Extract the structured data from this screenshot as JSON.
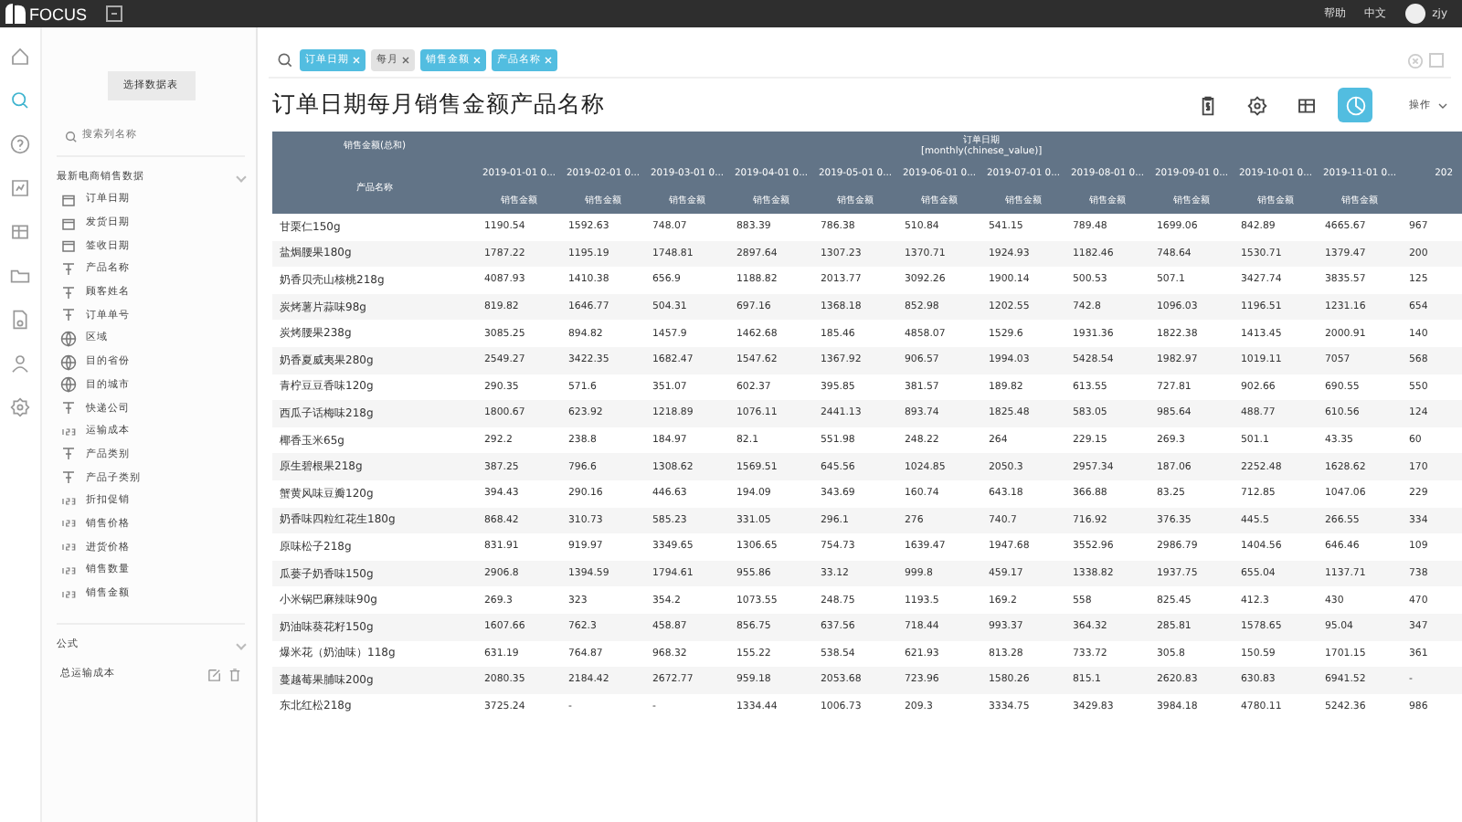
{
  "topbar": {
    "logo": "FOCUS",
    "links": [
      "帮助",
      "中文"
    ],
    "user": "zjy"
  },
  "rail": [
    {
      "kind": "home",
      "selected": false
    },
    {
      "kind": "search",
      "selected": true
    },
    {
      "kind": "help",
      "selected": false
    },
    {
      "kind": "chart",
      "selected": false
    },
    {
      "kind": "table",
      "selected": false
    },
    {
      "kind": "folder",
      "selected": false
    },
    {
      "kind": "file",
      "selected": false
    },
    {
      "kind": "user",
      "selected": false
    },
    {
      "kind": "settings",
      "selected": false
    }
  ],
  "sidebar": {
    "button": "选择数据表",
    "search_placeholder": "搜索列名称",
    "source": {
      "title": "最新电商销售数据",
      "items": [
        {
          "label": "订单日期",
          "kind": "date"
        },
        {
          "label": "发货日期",
          "kind": "date"
        },
        {
          "label": "签收日期",
          "kind": "date"
        },
        {
          "label": "产品名称",
          "kind": "text"
        },
        {
          "label": "顾客姓名",
          "kind": "text"
        },
        {
          "label": "订单单号",
          "kind": "text"
        },
        {
          "label": "区域",
          "kind": "geo"
        },
        {
          "label": "目的省份",
          "kind": "geo"
        },
        {
          "label": "目的城市",
          "kind": "geo"
        },
        {
          "label": "快递公司",
          "kind": "text"
        },
        {
          "label": "运输成本",
          "kind": "number"
        },
        {
          "label": "产品类别",
          "kind": "text"
        },
        {
          "label": "产品子类别",
          "kind": "text"
        },
        {
          "label": "折扣促销",
          "kind": "number"
        },
        {
          "label": "销售价格",
          "kind": "number"
        },
        {
          "label": "进货价格",
          "kind": "number"
        },
        {
          "label": "销售数量",
          "kind": "number"
        },
        {
          "label": "销售金额",
          "kind": "number"
        }
      ]
    },
    "formula": {
      "title": "公式",
      "items": [
        "总运输成本"
      ]
    }
  },
  "search": {
    "tokens": [
      {
        "label": "订单日期",
        "kind": "column"
      },
      {
        "label": "每月",
        "kind": "keyword"
      },
      {
        "label": "销售金额",
        "kind": "column"
      },
      {
        "label": "产品名称",
        "kind": "column"
      }
    ]
  },
  "title": "订单日期每月销售金额产品名称",
  "views": [
    {
      "kind": "money",
      "selected": false
    },
    {
      "kind": "settings",
      "selected": false
    },
    {
      "kind": "table",
      "selected": false
    },
    {
      "kind": "pie",
      "selected": true
    }
  ],
  "action": "操作",
  "table": {
    "measure": "销售金额(总和)",
    "group": "订单日期",
    "group_sub": "[monthly(chinese_value)]",
    "row_header": "产品名称",
    "columns": [
      "2019-01-01 0...",
      "2019-02-01 0...",
      "2019-03-01 0...",
      "2019-04-01 0...",
      "2019-05-01 0...",
      "2019-06-01 0...",
      "2019-07-01 0...",
      "2019-08-01 0...",
      "2019-09-01 0...",
      "2019-10-01 0...",
      "2019-11-01 0...",
      "202"
    ],
    "subheader": [
      "销售金额",
      "销售金额",
      "销售金额",
      "销售金额",
      "销售金额",
      "销售金额",
      "销售金额",
      "销售金额",
      "销售金额",
      "销售金额",
      "销售金额"
    ],
    "rows": [
      {
        "name": "甘栗仁150g",
        "values": [
          "1190.54",
          "1592.63",
          "748.07",
          "883.39",
          "786.38",
          "510.84",
          "541.15",
          "789.48",
          "1699.06",
          "842.89",
          "4665.67",
          "967"
        ]
      },
      {
        "name": "盐焗腰果180g",
        "values": [
          "1787.22",
          "1195.19",
          "1748.81",
          "2897.64",
          "1307.23",
          "1370.71",
          "1924.93",
          "1182.46",
          "748.64",
          "1530.71",
          "1379.47",
          "200"
        ]
      },
      {
        "name": "奶香贝壳山核桃218g",
        "values": [
          "4087.93",
          "1410.38",
          "656.9",
          "1188.82",
          "2013.77",
          "3092.26",
          "1900.14",
          "500.53",
          "507.1",
          "3427.74",
          "3835.57",
          "125"
        ]
      },
      {
        "name": "炭烤薯片蒜味98g",
        "values": [
          "819.82",
          "1646.77",
          "504.31",
          "697.16",
          "1368.18",
          "852.98",
          "1202.55",
          "742.8",
          "1096.03",
          "1196.51",
          "1231.16",
          "654"
        ]
      },
      {
        "name": "炭烤腰果238g",
        "values": [
          "3085.25",
          "894.82",
          "1457.9",
          "1462.68",
          "185.46",
          "4858.07",
          "1529.6",
          "1931.36",
          "1822.38",
          "1413.45",
          "2000.91",
          "140"
        ]
      },
      {
        "name": "奶香夏威夷果280g",
        "values": [
          "2549.27",
          "3422.35",
          "1682.47",
          "1547.62",
          "1367.92",
          "906.57",
          "1994.03",
          "5428.54",
          "1982.97",
          "1019.11",
          "7057",
          "568"
        ]
      },
      {
        "name": "青柠豆豆香味120g",
        "values": [
          "290.35",
          "571.6",
          "351.07",
          "602.37",
          "395.85",
          "381.57",
          "189.82",
          "613.55",
          "727.81",
          "902.66",
          "690.55",
          "550"
        ]
      },
      {
        "name": "西瓜子话梅味218g",
        "values": [
          "1800.67",
          "623.92",
          "1218.89",
          "1076.11",
          "2441.13",
          "893.74",
          "1825.48",
          "583.05",
          "985.64",
          "488.77",
          "610.56",
          "124"
        ]
      },
      {
        "name": "椰香玉米65g",
        "values": [
          "292.2",
          "238.8",
          "184.97",
          "82.1",
          "551.98",
          "248.22",
          "264",
          "229.15",
          "269.3",
          "501.1",
          "43.35",
          "60"
        ]
      },
      {
        "name": "原生碧根果218g",
        "values": [
          "387.25",
          "796.6",
          "1308.62",
          "1569.51",
          "645.56",
          "1024.85",
          "2050.3",
          "2957.34",
          "187.06",
          "2252.48",
          "1628.62",
          "170"
        ]
      },
      {
        "name": "蟹黄风味豆瓣120g",
        "values": [
          "394.43",
          "290.16",
          "446.63",
          "194.09",
          "343.69",
          "160.74",
          "643.18",
          "366.88",
          "83.25",
          "712.85",
          "1047.06",
          "229"
        ]
      },
      {
        "name": "奶香味四粒红花生180g",
        "values": [
          "868.42",
          "310.73",
          "585.23",
          "331.05",
          "296.1",
          "276",
          "740.7",
          "716.92",
          "376.35",
          "445.5",
          "266.55",
          "334"
        ]
      },
      {
        "name": "原味松子218g",
        "values": [
          "831.91",
          "919.97",
          "3349.65",
          "1306.65",
          "754.73",
          "1639.47",
          "1947.68",
          "3552.96",
          "2986.79",
          "1404.56",
          "646.46",
          "109"
        ]
      },
      {
        "name": "瓜蒌子奶香味150g",
        "values": [
          "2906.8",
          "1394.59",
          "1794.61",
          "955.86",
          "33.12",
          "999.8",
          "459.17",
          "1338.82",
          "1937.75",
          "655.04",
          "1137.71",
          "738"
        ]
      },
      {
        "name": "小米锅巴麻辣味90g",
        "values": [
          "269.3",
          "323",
          "354.2",
          "1073.55",
          "248.75",
          "1193.5",
          "169.2",
          "558",
          "825.45",
          "412.3",
          "430",
          "470"
        ]
      },
      {
        "name": "奶油味葵花籽150g",
        "values": [
          "1607.66",
          "762.3",
          "458.87",
          "856.75",
          "637.56",
          "718.44",
          "993.37",
          "364.32",
          "285.81",
          "1578.65",
          "95.04",
          "347"
        ]
      },
      {
        "name": "爆米花（奶油味）118g",
        "values": [
          "631.19",
          "764.87",
          "968.32",
          "155.22",
          "538.54",
          "621.93",
          "813.28",
          "733.72",
          "305.8",
          "150.59",
          "1701.15",
          "361"
        ]
      },
      {
        "name": "蔓越莓果脯味200g",
        "values": [
          "2080.35",
          "2184.42",
          "2672.77",
          "959.18",
          "2053.68",
          "723.96",
          "1580.26",
          "815.1",
          "2620.83",
          "630.83",
          "6941.52",
          "-"
        ]
      },
      {
        "name": "东北红松218g",
        "values": [
          "3725.24",
          "-",
          "-",
          "1334.44",
          "1006.73",
          "209.3",
          "3334.75",
          "3429.83",
          "3984.18",
          "4780.11",
          "5242.36",
          "986"
        ]
      }
    ]
  }
}
